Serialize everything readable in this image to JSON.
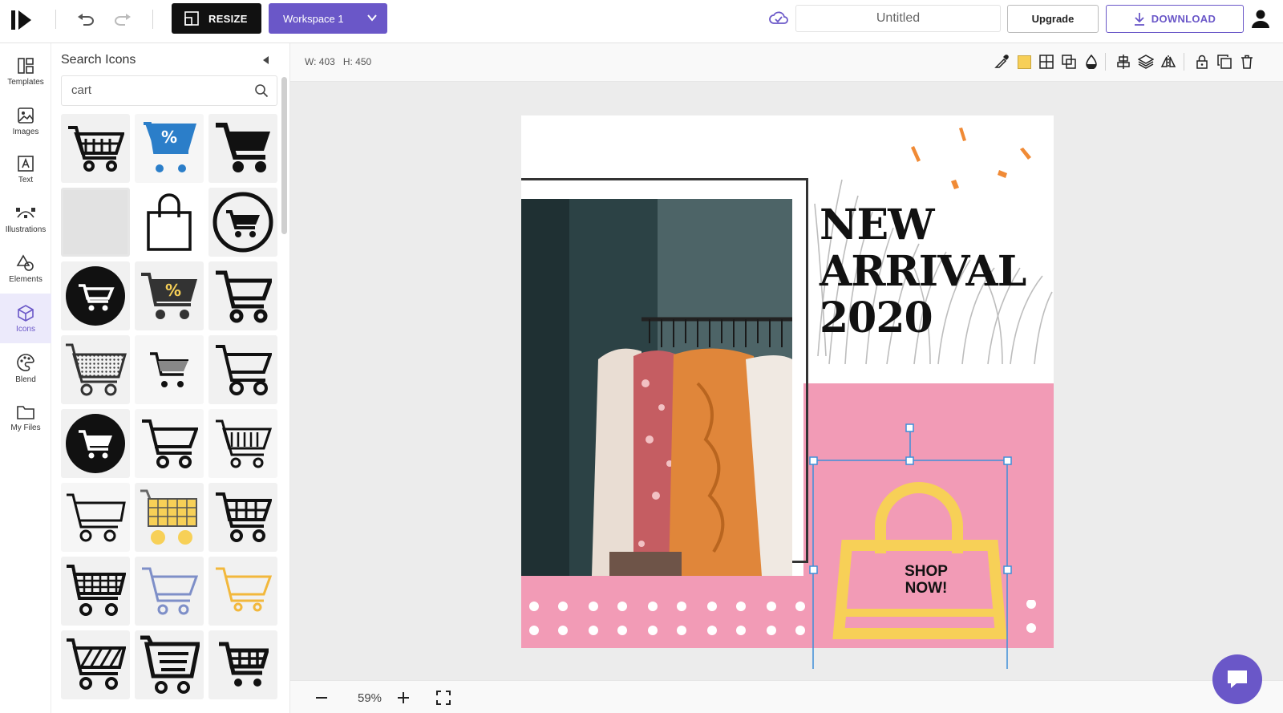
{
  "topbar": {
    "resize_label": "RESIZE",
    "workspace_label": "Workspace 1",
    "document_title": "Untitled",
    "upgrade_label": "Upgrade",
    "download_label": "DOWNLOAD"
  },
  "rail": {
    "items": [
      {
        "label": "Templates",
        "icon": "templates-icon"
      },
      {
        "label": "Images",
        "icon": "images-icon"
      },
      {
        "label": "Text",
        "icon": "text-icon"
      },
      {
        "label": "Illustrations",
        "icon": "illustrations-icon"
      },
      {
        "label": "Elements",
        "icon": "elements-icon"
      },
      {
        "label": "Icons",
        "icon": "icons-icon",
        "active": true
      },
      {
        "label": "Blend",
        "icon": "blend-icon"
      },
      {
        "label": "My Files",
        "icon": "my-files-icon"
      }
    ]
  },
  "panel": {
    "title": "Search Icons",
    "search_value": "cart",
    "results": [
      "shopping-cart-icon",
      "discount-cart-icon",
      "filled-cart-icon",
      "placeholder-icon",
      "shopping-bag-icon",
      "circle-cart-icon",
      "black-circle-cart-icon",
      "discount-cart-yellow-icon",
      "outline-cart-icon",
      "dotted-basket-cart-icon",
      "small-cart-icon",
      "outline-cart-wheels-icon",
      "black-circle-cart-alt-icon",
      "outline-cart-alt-icon",
      "striped-cart-icon",
      "line-cart-icon",
      "yellow-grid-cart-icon",
      "grid-cart-icon",
      "mesh-cart-icon",
      "blue-outline-cart-icon",
      "yellow-outline-cart-icon",
      "hatched-cart-icon",
      "list-cart-icon",
      "bold-cart-icon"
    ]
  },
  "toolbar": {
    "width_label": "W: 403",
    "height_label": "H: 450",
    "fill_color": "#f7cf57"
  },
  "design": {
    "headline_lines": [
      "NEW",
      "ARRIVAL",
      "2020"
    ],
    "cta_lines": [
      "SHOP",
      "NOW!"
    ],
    "pink": "#f29bb6",
    "bag_color": "#f7d057",
    "accent_orange": "#f08a35"
  },
  "zoom": {
    "value": "59%"
  },
  "colors": {
    "brand": "#6a57c8"
  }
}
